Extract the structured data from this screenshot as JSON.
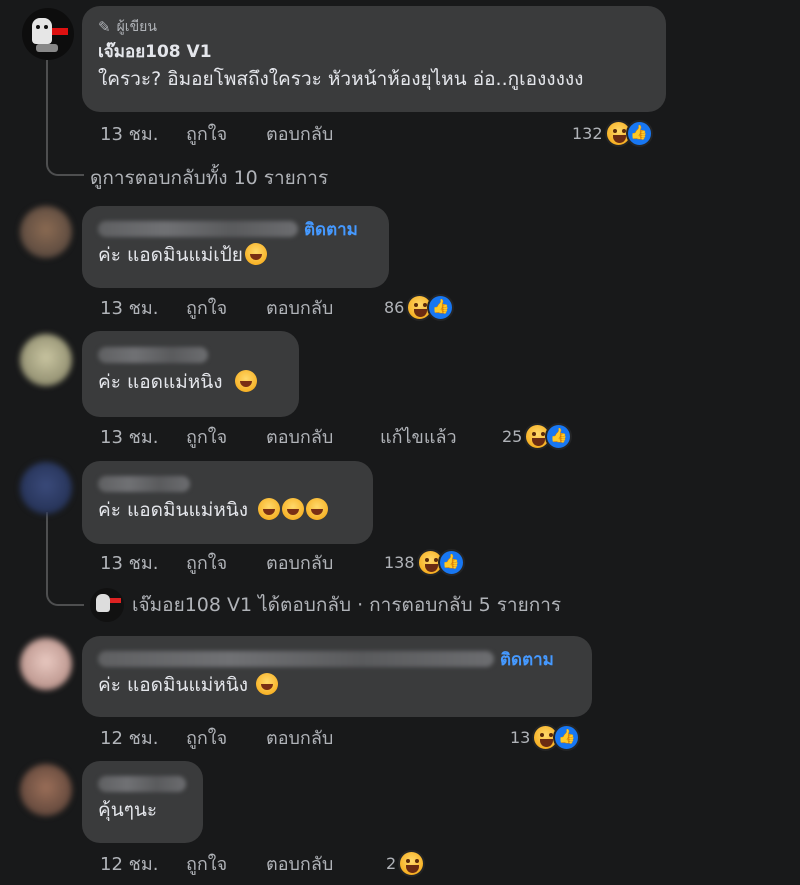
{
  "comments": [
    {
      "id": "c1",
      "author_badge": "ผู้เขียน",
      "author": "เจ๊มอย108 V1",
      "text": "ใครวะ? อิมอยโพสถึงใครวะ หัวหน้าห้องยุไหน อ่อ..กูเองงงงง",
      "time": "13 ชม.",
      "like_label": "ถูกใจ",
      "reply_label": "ตอบกลับ",
      "reactions": "132",
      "view_replies": "ดูการตอบกลับทั้ง 10 รายการ"
    },
    {
      "id": "c2",
      "follow_label": "ติดตาม",
      "text": "ค่ะ แอดมินแม่เป้ย",
      "time": "13 ชม.",
      "like_label": "ถูกใจ",
      "reply_label": "ตอบกลับ",
      "reactions": "86"
    },
    {
      "id": "c3",
      "text": "ค่ะ แอดแม่หนิง",
      "time": "13 ชม.",
      "like_label": "ถูกใจ",
      "reply_label": "ตอบกลับ",
      "edited_label": "แก้ไขแล้ว",
      "reactions": "25"
    },
    {
      "id": "c4",
      "text": "ค่ะ แอดมินแม่หนิง",
      "time": "13 ชม.",
      "like_label": "ถูกใจ",
      "reply_label": "ตอบกลับ",
      "reactions": "138",
      "replied_summary": "เจ๊มอย108 V1 ได้ตอบกลับ · การตอบกลับ 5 รายการ"
    },
    {
      "id": "c5",
      "follow_label": "ติดตาม",
      "text": "ค่ะ แอดมินแม่หนิง",
      "time": "12 ชม.",
      "like_label": "ถูกใจ",
      "reply_label": "ตอบกลับ",
      "reactions": "13"
    },
    {
      "id": "c6",
      "text": "คุ้นๆนะ",
      "time": "12 ชม.",
      "like_label": "ถูกใจ",
      "reply_label": "ตอบกลับ",
      "reactions": "2"
    }
  ],
  "icons": {
    "pencil": "pencil-icon",
    "laugh": "laughing-emoji-icon",
    "like": "like-reaction-icon",
    "rofl": "rofl-emoji-icon",
    "sleepy": "sleepy-emoji-icon"
  },
  "colors": {
    "background": "#18191a",
    "bubble": "#3a3b3c",
    "link": "#4599ff",
    "muted": "#b0b3b8"
  }
}
